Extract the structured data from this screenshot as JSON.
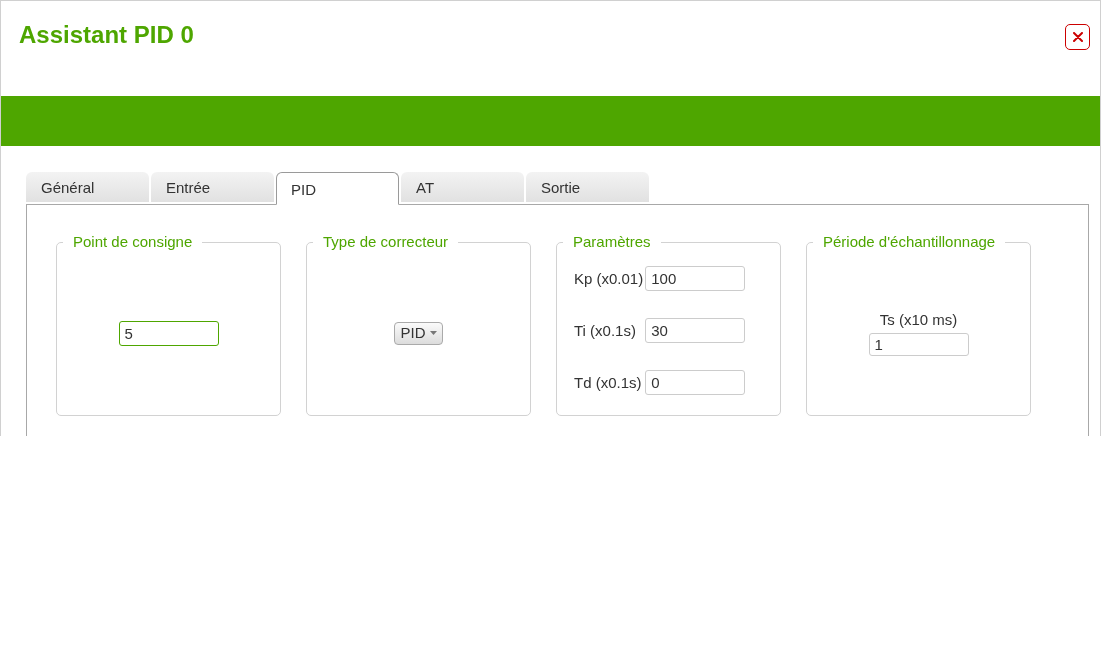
{
  "dialog": {
    "title": "Assistant PID 0"
  },
  "tabs": [
    {
      "label": "Général",
      "selected": false
    },
    {
      "label": "Entrée",
      "selected": false
    },
    {
      "label": "PID",
      "selected": true
    },
    {
      "label": "AT",
      "selected": false
    },
    {
      "label": "Sortie",
      "selected": false
    }
  ],
  "groups": [
    {
      "kind": "centered",
      "legend": "Point de consigne",
      "fields": [
        {
          "value": "5",
          "focused": true
        }
      ]
    },
    {
      "kind": "dropdown",
      "legend": "Type de correcteur",
      "value": "PID"
    },
    {
      "kind": "grid",
      "legend": "Paramètres",
      "fields": [
        {
          "label": "Kp (x0.01)",
          "value": "100",
          "focused": false
        },
        {
          "label": "Ti (x0.1s)",
          "value": "30",
          "focused": false
        },
        {
          "label": "Td (x0.1s)",
          "value": "0",
          "focused": false
        }
      ]
    },
    {
      "kind": "centered",
      "legend": "Période d'échantillonnage",
      "fields": [
        {
          "label": "Ts (x10 ms)",
          "value": "1",
          "focused": false
        }
      ]
    }
  ]
}
